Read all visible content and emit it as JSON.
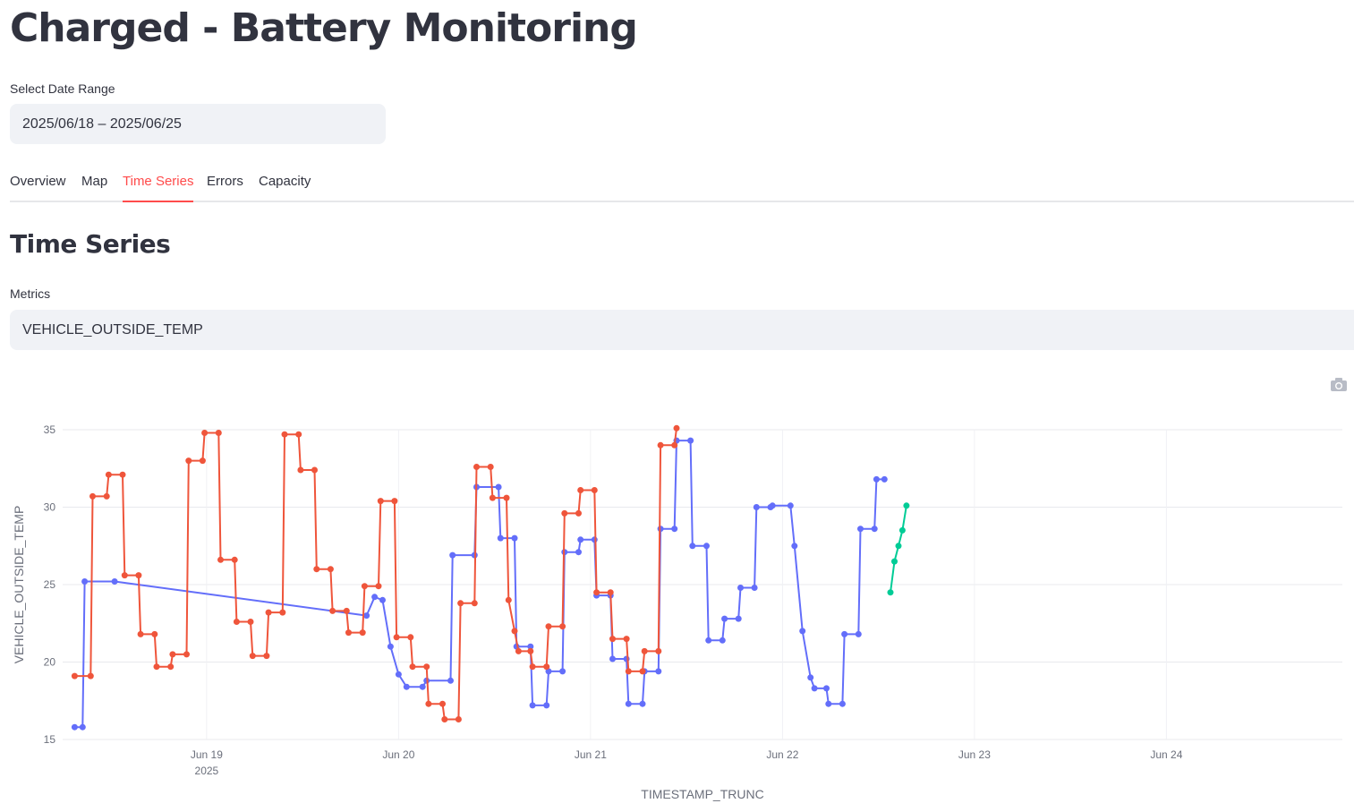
{
  "app": {
    "title": "Charged - Battery Monitoring"
  },
  "date_range": {
    "label": "Select Date Range",
    "value": "2025/06/18 – 2025/06/25"
  },
  "tabs": [
    {
      "label": "Overview"
    },
    {
      "label": "Map"
    },
    {
      "label": "Time Series",
      "active": true
    },
    {
      "label": "Errors"
    },
    {
      "label": "Capacity"
    }
  ],
  "section": {
    "title": "Time Series"
  },
  "metrics": {
    "label": "Metrics",
    "value": "VEHICLE_OUTSIDE_TEMP"
  },
  "toolbar": {
    "icon": "camera-icon"
  },
  "chart_data": {
    "type": "line",
    "xlabel": "TIMESTAMP_TRUNC",
    "ylabel": "VEHICLE_OUTSIDE_TEMP",
    "ylim": [
      15,
      35
    ],
    "xlim": [
      "2025-06-18 06:00",
      "2025-06-24 22:00"
    ],
    "yticks": [
      15,
      20,
      25,
      30,
      35
    ],
    "xticks": [
      {
        "x": "2025-06-19",
        "label": "Jun 19",
        "sublabel": "2025"
      },
      {
        "x": "2025-06-20",
        "label": "Jun 20"
      },
      {
        "x": "2025-06-21",
        "label": "Jun 21"
      },
      {
        "x": "2025-06-22",
        "label": "Jun 22"
      },
      {
        "x": "2025-06-23",
        "label": "Jun 23"
      },
      {
        "x": "2025-06-24",
        "label": "Jun 24"
      }
    ],
    "grid": true,
    "series": [
      {
        "color": "#636efa",
        "points": [
          [
            "2025-06-18 07:30",
            15.8
          ],
          [
            "2025-06-18 08:30",
            15.8
          ],
          [
            "2025-06-18 08:45",
            25.2
          ],
          [
            "2025-06-18 12:30",
            25.2
          ],
          [
            "2025-06-19 20:00",
            23.0
          ],
          [
            "2025-06-19 21:00",
            24.2
          ],
          [
            "2025-06-19 22:00",
            24.0
          ],
          [
            "2025-06-19 23:00",
            21.0
          ],
          [
            "2025-06-20 00:00",
            19.2
          ],
          [
            "2025-06-20 01:00",
            18.4
          ],
          [
            "2025-06-20 03:00",
            18.4
          ],
          [
            "2025-06-20 03:30",
            18.8
          ],
          [
            "2025-06-20 06:30",
            18.8
          ],
          [
            "2025-06-20 06:45",
            26.9
          ],
          [
            "2025-06-20 09:30",
            26.9
          ],
          [
            "2025-06-20 09:45",
            31.3
          ],
          [
            "2025-06-20 12:30",
            31.3
          ],
          [
            "2025-06-20 12:45",
            28.0
          ],
          [
            "2025-06-20 14:30",
            28.0
          ],
          [
            "2025-06-20 14:45",
            21.0
          ],
          [
            "2025-06-20 16:30",
            21.0
          ],
          [
            "2025-06-20 16:45",
            17.2
          ],
          [
            "2025-06-20 18:30",
            17.2
          ],
          [
            "2025-06-20 18:45",
            19.4
          ],
          [
            "2025-06-20 20:30",
            19.4
          ],
          [
            "2025-06-20 20:45",
            27.1
          ],
          [
            "2025-06-20 22:30",
            27.1
          ],
          [
            "2025-06-20 22:45",
            27.9
          ],
          [
            "2025-06-21 00:30",
            27.9
          ],
          [
            "2025-06-21 00:45",
            24.3
          ],
          [
            "2025-06-21 02:30",
            24.3
          ],
          [
            "2025-06-21 02:45",
            20.2
          ],
          [
            "2025-06-21 04:30",
            20.2
          ],
          [
            "2025-06-21 04:45",
            17.3
          ],
          [
            "2025-06-21 06:30",
            17.3
          ],
          [
            "2025-06-21 06:45",
            19.4
          ],
          [
            "2025-06-21 08:30",
            19.4
          ],
          [
            "2025-06-21 08:45",
            28.6
          ],
          [
            "2025-06-21 10:30",
            28.6
          ],
          [
            "2025-06-21 10:45",
            34.3
          ],
          [
            "2025-06-21 12:30",
            34.3
          ],
          [
            "2025-06-21 12:45",
            27.5
          ],
          [
            "2025-06-21 14:30",
            27.5
          ],
          [
            "2025-06-21 14:45",
            21.4
          ],
          [
            "2025-06-21 16:30",
            21.4
          ],
          [
            "2025-06-21 16:45",
            22.8
          ],
          [
            "2025-06-21 18:30",
            22.8
          ],
          [
            "2025-06-21 18:45",
            24.8
          ],
          [
            "2025-06-21 20:30",
            24.8
          ],
          [
            "2025-06-21 20:45",
            30.0
          ],
          [
            "2025-06-21 22:30",
            30.0
          ],
          [
            "2025-06-21 22:45",
            30.1
          ],
          [
            "2025-06-22 01:00",
            30.1
          ],
          [
            "2025-06-22 01:30",
            27.5
          ],
          [
            "2025-06-22 02:30",
            22.0
          ],
          [
            "2025-06-22 03:30",
            19.0
          ],
          [
            "2025-06-22 04:00",
            18.3
          ],
          [
            "2025-06-22 05:30",
            18.3
          ],
          [
            "2025-06-22 05:45",
            17.3
          ],
          [
            "2025-06-22 07:30",
            17.3
          ],
          [
            "2025-06-22 07:45",
            21.8
          ],
          [
            "2025-06-22 09:30",
            21.8
          ],
          [
            "2025-06-22 09:45",
            28.6
          ],
          [
            "2025-06-22 11:30",
            28.6
          ],
          [
            "2025-06-22 11:45",
            31.8
          ],
          [
            "2025-06-22 12:45",
            31.8
          ]
        ]
      },
      {
        "color": "#ef553b",
        "points": [
          [
            "2025-06-18 07:30",
            19.1
          ],
          [
            "2025-06-18 09:30",
            19.1
          ],
          [
            "2025-06-18 09:45",
            30.7
          ],
          [
            "2025-06-18 11:30",
            30.7
          ],
          [
            "2025-06-18 11:45",
            32.1
          ],
          [
            "2025-06-18 13:30",
            32.1
          ],
          [
            "2025-06-18 13:45",
            25.6
          ],
          [
            "2025-06-18 15:30",
            25.6
          ],
          [
            "2025-06-18 15:45",
            21.8
          ],
          [
            "2025-06-18 17:30",
            21.8
          ],
          [
            "2025-06-18 17:45",
            19.7
          ],
          [
            "2025-06-18 19:30",
            19.7
          ],
          [
            "2025-06-18 19:45",
            20.5
          ],
          [
            "2025-06-18 21:30",
            20.5
          ],
          [
            "2025-06-18 21:45",
            33.0
          ],
          [
            "2025-06-18 23:30",
            33.0
          ],
          [
            "2025-06-18 23:45",
            34.8
          ],
          [
            "2025-06-19 01:30",
            34.8
          ],
          [
            "2025-06-19 01:45",
            26.6
          ],
          [
            "2025-06-19 03:30",
            26.6
          ],
          [
            "2025-06-19 03:45",
            22.6
          ],
          [
            "2025-06-19 05:30",
            22.6
          ],
          [
            "2025-06-19 05:45",
            20.4
          ],
          [
            "2025-06-19 07:30",
            20.4
          ],
          [
            "2025-06-19 07:45",
            23.2
          ],
          [
            "2025-06-19 09:30",
            23.2
          ],
          [
            "2025-06-19 09:45",
            34.7
          ],
          [
            "2025-06-19 11:30",
            34.7
          ],
          [
            "2025-06-19 11:45",
            32.4
          ],
          [
            "2025-06-19 13:30",
            32.4
          ],
          [
            "2025-06-19 13:45",
            26.0
          ],
          [
            "2025-06-19 15:30",
            26.0
          ],
          [
            "2025-06-19 15:45",
            23.3
          ],
          [
            "2025-06-19 17:30",
            23.3
          ],
          [
            "2025-06-19 17:45",
            21.9
          ],
          [
            "2025-06-19 19:30",
            21.9
          ],
          [
            "2025-06-19 19:45",
            24.9
          ],
          [
            "2025-06-19 21:30",
            24.9
          ],
          [
            "2025-06-19 21:45",
            30.4
          ],
          [
            "2025-06-19 23:30",
            30.4
          ],
          [
            "2025-06-19 23:45",
            21.6
          ],
          [
            "2025-06-20 01:30",
            21.6
          ],
          [
            "2025-06-20 01:45",
            19.7
          ],
          [
            "2025-06-20 03:30",
            19.7
          ],
          [
            "2025-06-20 03:45",
            17.3
          ],
          [
            "2025-06-20 05:30",
            17.3
          ],
          [
            "2025-06-20 05:45",
            16.3
          ],
          [
            "2025-06-20 07:30",
            16.3
          ],
          [
            "2025-06-20 07:45",
            23.8
          ],
          [
            "2025-06-20 09:30",
            23.8
          ],
          [
            "2025-06-20 09:45",
            32.6
          ],
          [
            "2025-06-20 11:30",
            32.6
          ],
          [
            "2025-06-20 11:45",
            30.6
          ],
          [
            "2025-06-20 13:30",
            30.6
          ],
          [
            "2025-06-20 13:45",
            24.0
          ],
          [
            "2025-06-20 14:30",
            22.0
          ],
          [
            "2025-06-20 15:00",
            20.7
          ],
          [
            "2025-06-20 16:30",
            20.7
          ],
          [
            "2025-06-20 16:45",
            19.7
          ],
          [
            "2025-06-20 18:30",
            19.7
          ],
          [
            "2025-06-20 18:45",
            22.3
          ],
          [
            "2025-06-20 20:30",
            22.3
          ],
          [
            "2025-06-20 20:45",
            29.6
          ],
          [
            "2025-06-20 22:30",
            29.6
          ],
          [
            "2025-06-20 22:45",
            31.1
          ],
          [
            "2025-06-21 00:30",
            31.1
          ],
          [
            "2025-06-21 00:45",
            24.5
          ],
          [
            "2025-06-21 02:30",
            24.5
          ],
          [
            "2025-06-21 02:45",
            21.5
          ],
          [
            "2025-06-21 04:30",
            21.5
          ],
          [
            "2025-06-21 04:45",
            19.4
          ],
          [
            "2025-06-21 06:30",
            19.4
          ],
          [
            "2025-06-21 06:45",
            20.7
          ],
          [
            "2025-06-21 08:30",
            20.7
          ],
          [
            "2025-06-21 08:45",
            34.0
          ],
          [
            "2025-06-21 10:30",
            34.0
          ],
          [
            "2025-06-21 10:45",
            35.1
          ]
        ]
      },
      {
        "color": "#00cc96",
        "points": [
          [
            "2025-06-22 13:30",
            24.5
          ],
          [
            "2025-06-22 14:00",
            26.5
          ],
          [
            "2025-06-22 14:30",
            27.5
          ],
          [
            "2025-06-22 15:00",
            28.5
          ],
          [
            "2025-06-22 15:30",
            30.1
          ]
        ]
      }
    ]
  }
}
